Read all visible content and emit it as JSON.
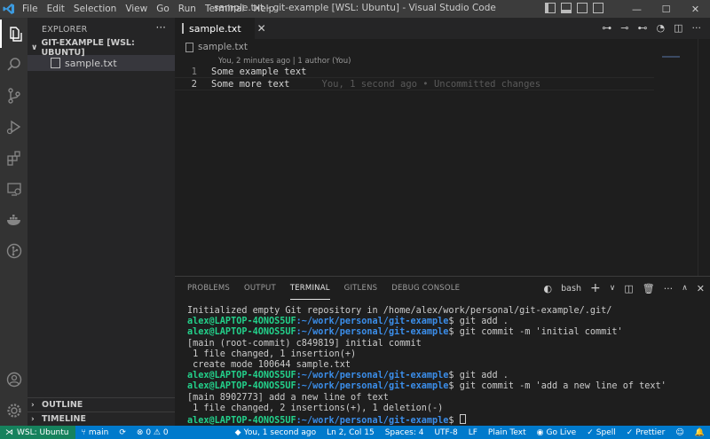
{
  "titlebar": {
    "menu": [
      "File",
      "Edit",
      "Selection",
      "View",
      "Go",
      "Run",
      "Terminal",
      "Help"
    ],
    "title": "sample.txt - git-example [WSL: Ubuntu] - Visual Studio Code",
    "brand_color": "#007acc"
  },
  "sidebar": {
    "title": "EXPLORER",
    "more": "···",
    "folder": "GIT-EXAMPLE [WSL: UBUNTU]",
    "files": [
      "sample.txt"
    ],
    "outline": "OUTLINE",
    "timeline": "TIMELINE"
  },
  "editor": {
    "tab": "sample.txt",
    "breadcrumb": "sample.txt",
    "codelens": "You, 2 minutes ago | 1 author (You)",
    "lines": [
      {
        "num": "1",
        "text": "Some example text",
        "blame": ""
      },
      {
        "num": "2",
        "text": "Some more text",
        "blame": "You, 1 second ago • Uncommitted changes"
      }
    ]
  },
  "panel": {
    "tabs": [
      "PROBLEMS",
      "OUTPUT",
      "TERMINAL",
      "GITLENS",
      "DEBUG CONSOLE"
    ],
    "active_tab": "TERMINAL",
    "shell": "bash",
    "terminal": [
      {
        "type": "out",
        "text": "Initialized empty Git repository in /home/alex/work/personal/git-example/.git/"
      },
      {
        "type": "prompt",
        "user": "alex@LAPTOP-4ONOS5UF",
        "path": ":~/work/personal/git-example",
        "cmd": "$ git add ."
      },
      {
        "type": "prompt",
        "user": "alex@LAPTOP-4ONOS5UF",
        "path": ":~/work/personal/git-example",
        "cmd": "$ git commit -m 'initial commit'"
      },
      {
        "type": "out",
        "text": "[main (root-commit) c849819] initial commit"
      },
      {
        "type": "out",
        "text": " 1 file changed, 1 insertion(+)"
      },
      {
        "type": "out",
        "text": " create mode 100644 sample.txt"
      },
      {
        "type": "prompt",
        "user": "alex@LAPTOP-4ONOS5UF",
        "path": ":~/work/personal/git-example",
        "cmd": "$ git add ."
      },
      {
        "type": "prompt",
        "user": "alex@LAPTOP-4ONOS5UF",
        "path": ":~/work/personal/git-example",
        "cmd": "$ git commit -m 'add a new line of text'"
      },
      {
        "type": "out",
        "text": "[main 8902773] add a new line of text"
      },
      {
        "type": "out",
        "text": " 1 file changed, 2 insertions(+), 1 deletion(-)"
      },
      {
        "type": "prompt",
        "user": "alex@LAPTOP-4ONOS5UF",
        "path": ":~/work/personal/git-example",
        "cmd": "$ ",
        "cursor": true
      }
    ]
  },
  "statusbar": {
    "remote": "WSL: Ubuntu",
    "branch": "main",
    "problems": "⊗ 0 ⚠ 0",
    "blame": "You, 1 second ago",
    "position": "Ln 2, Col 15",
    "spaces": "Spaces: 4",
    "encoding": "UTF-8",
    "eol": "LF",
    "language": "Plain Text",
    "golive": "Go Live",
    "spell": "Spell",
    "prettier": "Prettier",
    "remote_color": "#16825d",
    "bar_color": "#007acc"
  }
}
